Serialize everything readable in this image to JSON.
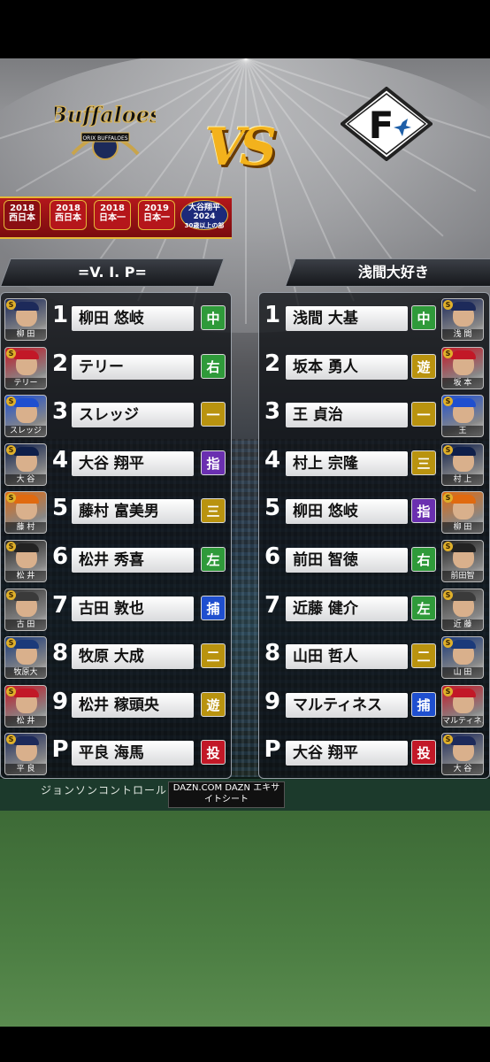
{
  "match": {
    "team_a": {
      "logo_text": "Buffaloes",
      "logo_sub": "ORIX BUFFALOES"
    },
    "vs_label": "VS",
    "team_b": {
      "logo_text": "F"
    }
  },
  "badges": [
    {
      "line1": "2018",
      "line2": "西日本"
    },
    {
      "line1": "2018",
      "line2": "西日本"
    },
    {
      "line1": "2018",
      "line2": "日本一"
    },
    {
      "line1": "2019",
      "line2": "日本一"
    },
    {
      "line1": "大谷翔平",
      "line2": "2024",
      "line3": "30歳以上の部"
    }
  ],
  "teams": {
    "a": {
      "name": "=V. I. P="
    },
    "b": {
      "name": "浅間大好き"
    }
  },
  "lineup_a": [
    {
      "order": "1",
      "name": "柳田 悠岐",
      "pos": "中",
      "card": "柳 田"
    },
    {
      "order": "2",
      "name": "テリー",
      "pos": "右",
      "card": "テリー"
    },
    {
      "order": "3",
      "name": "スレッジ",
      "pos": "一",
      "card": "スレッジ"
    },
    {
      "order": "4",
      "name": "大谷 翔平",
      "pos": "指",
      "card": "大 谷"
    },
    {
      "order": "5",
      "name": "藤村 富美男",
      "pos": "三",
      "card": "藤 村"
    },
    {
      "order": "6",
      "name": "松井 秀喜",
      "pos": "左",
      "card": "松 井"
    },
    {
      "order": "7",
      "name": "古田 敦也",
      "pos": "捕",
      "card": "古 田"
    },
    {
      "order": "8",
      "name": "牧原 大成",
      "pos": "二",
      "card": "牧原大"
    },
    {
      "order": "9",
      "name": "松井 稼頭央",
      "pos": "遊",
      "card": "松 井"
    },
    {
      "order": "P",
      "name": "平良 海馬",
      "pos": "投",
      "card": "平 良"
    }
  ],
  "lineup_b": [
    {
      "order": "1",
      "name": "浅間 大基",
      "pos": "中",
      "card": "浅 間"
    },
    {
      "order": "2",
      "name": "坂本 勇人",
      "pos": "遊",
      "card": "坂 本"
    },
    {
      "order": "3",
      "name": "王 貞治",
      "pos": "一",
      "card": "王"
    },
    {
      "order": "4",
      "name": "村上 宗隆",
      "pos": "三",
      "card": "村 上"
    },
    {
      "order": "5",
      "name": "柳田 悠岐",
      "pos": "指",
      "card": "柳 田"
    },
    {
      "order": "6",
      "name": "前田 智徳",
      "pos": "右",
      "card": "前田智"
    },
    {
      "order": "7",
      "name": "近藤 健介",
      "pos": "左",
      "card": "近 藤"
    },
    {
      "order": "8",
      "name": "山田 哲人",
      "pos": "二",
      "card": "山 田"
    },
    {
      "order": "9",
      "name": "マルティネス",
      "pos": "捕",
      "card": "マルティネス"
    },
    {
      "order": "P",
      "name": "大谷 翔平",
      "pos": "投",
      "card": "大 谷"
    }
  ],
  "position_colors": {
    "中": "#2f9a3a",
    "右": "#2f9a3a",
    "左": "#2f9a3a",
    "一": "#b9930f",
    "二": "#b9930f",
    "三": "#b9930f",
    "遊": "#b9930f",
    "指": "#6a2fb0",
    "捕": "#1f4fcf",
    "投": "#c21827"
  },
  "card_mark": "S",
  "stadium_ads": {
    "ad1": "ジョンソンコントロールズ Johnson Controls",
    "ad2": "DAZN.COM DAZN エキサイトシート"
  }
}
